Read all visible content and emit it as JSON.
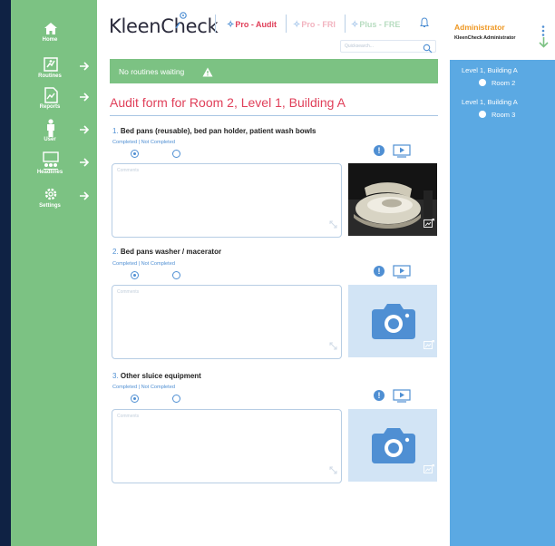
{
  "app": {
    "logo_text": "KleenCheck",
    "brand_accent": "#e0405a",
    "brand_green": "#7cc283",
    "brand_blue": "#5ba9e3"
  },
  "sidebar": {
    "items": [
      {
        "label": "Home",
        "icon": "home-icon"
      },
      {
        "label": "Routines",
        "icon": "routines-icon"
      },
      {
        "label": "Reports",
        "icon": "reports-icon"
      },
      {
        "label": "User",
        "icon": "user-icon"
      },
      {
        "label": "Headlines",
        "icon": "headlines-icon"
      },
      {
        "label": "Settings",
        "icon": "settings-icon"
      }
    ]
  },
  "header": {
    "tabs": [
      {
        "label": "Pro - Audit",
        "state": "active"
      },
      {
        "label": "Pro - FRI",
        "state": "inactive"
      },
      {
        "label": "Plus - FRE",
        "state": "inactive"
      }
    ],
    "search_placeholder": "Quicksearch..."
  },
  "banner": {
    "text": "No routines waiting"
  },
  "form": {
    "title": "Audit form for Room 2, Level 1, Building A",
    "completed_label": "Completed",
    "not_completed_label": "Not Completed",
    "comment_placeholder": "Comments",
    "questions": [
      {
        "number": "1.",
        "title": "Bed pans (reusable), bed pan holder, patient wash bowls",
        "selected": "Completed",
        "has_photo": true
      },
      {
        "number": "2.",
        "title": "Bed pans washer / macerator",
        "selected": "Completed",
        "has_photo": false
      },
      {
        "number": "3.",
        "title": "Other sluice equipment",
        "selected": "Completed",
        "has_photo": false
      }
    ]
  },
  "user_panel": {
    "role": "Administrator",
    "name": "KleenCheck Administrator",
    "locations": [
      {
        "building": "Level 1, Building A",
        "room": "Room 2"
      },
      {
        "building": "Level 1, Building A",
        "room": "Room 3"
      }
    ]
  }
}
